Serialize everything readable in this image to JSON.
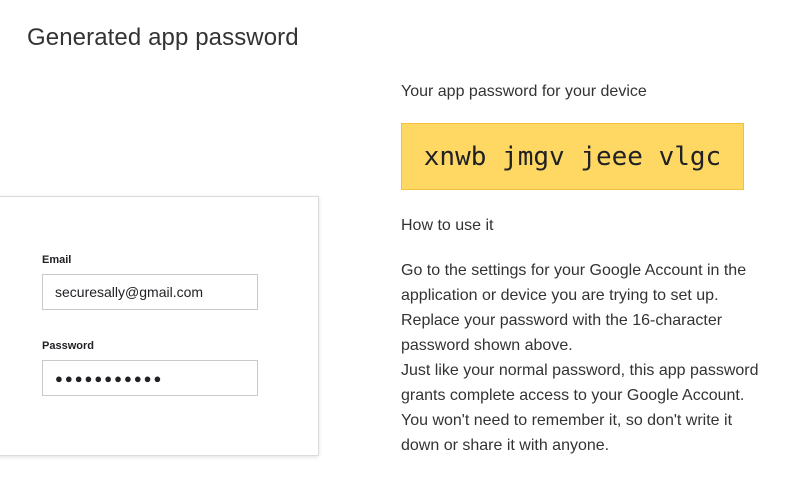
{
  "page": {
    "title": "Generated app password"
  },
  "signin_card": {
    "email_label": "Email",
    "email_value": "securesally@gmail.com",
    "password_label": "Password",
    "password_value": "●●●●●●●●●●●"
  },
  "result": {
    "heading": "Your app password for your device",
    "app_password": "xnwb jmgv jeee vlgc",
    "how_to_heading": "How to use it",
    "instructions_p1": "Go to the settings for your Google Account in the application or device you are trying to set up. Replace your password with the 16-character password shown above.",
    "instructions_p2": "Just like your normal password, this app password grants complete access to your Google Account. You won't need to remember it, so don't write it down or share it with anyone."
  },
  "colors": {
    "password_highlight": "#ffd863",
    "text": "#333333"
  }
}
